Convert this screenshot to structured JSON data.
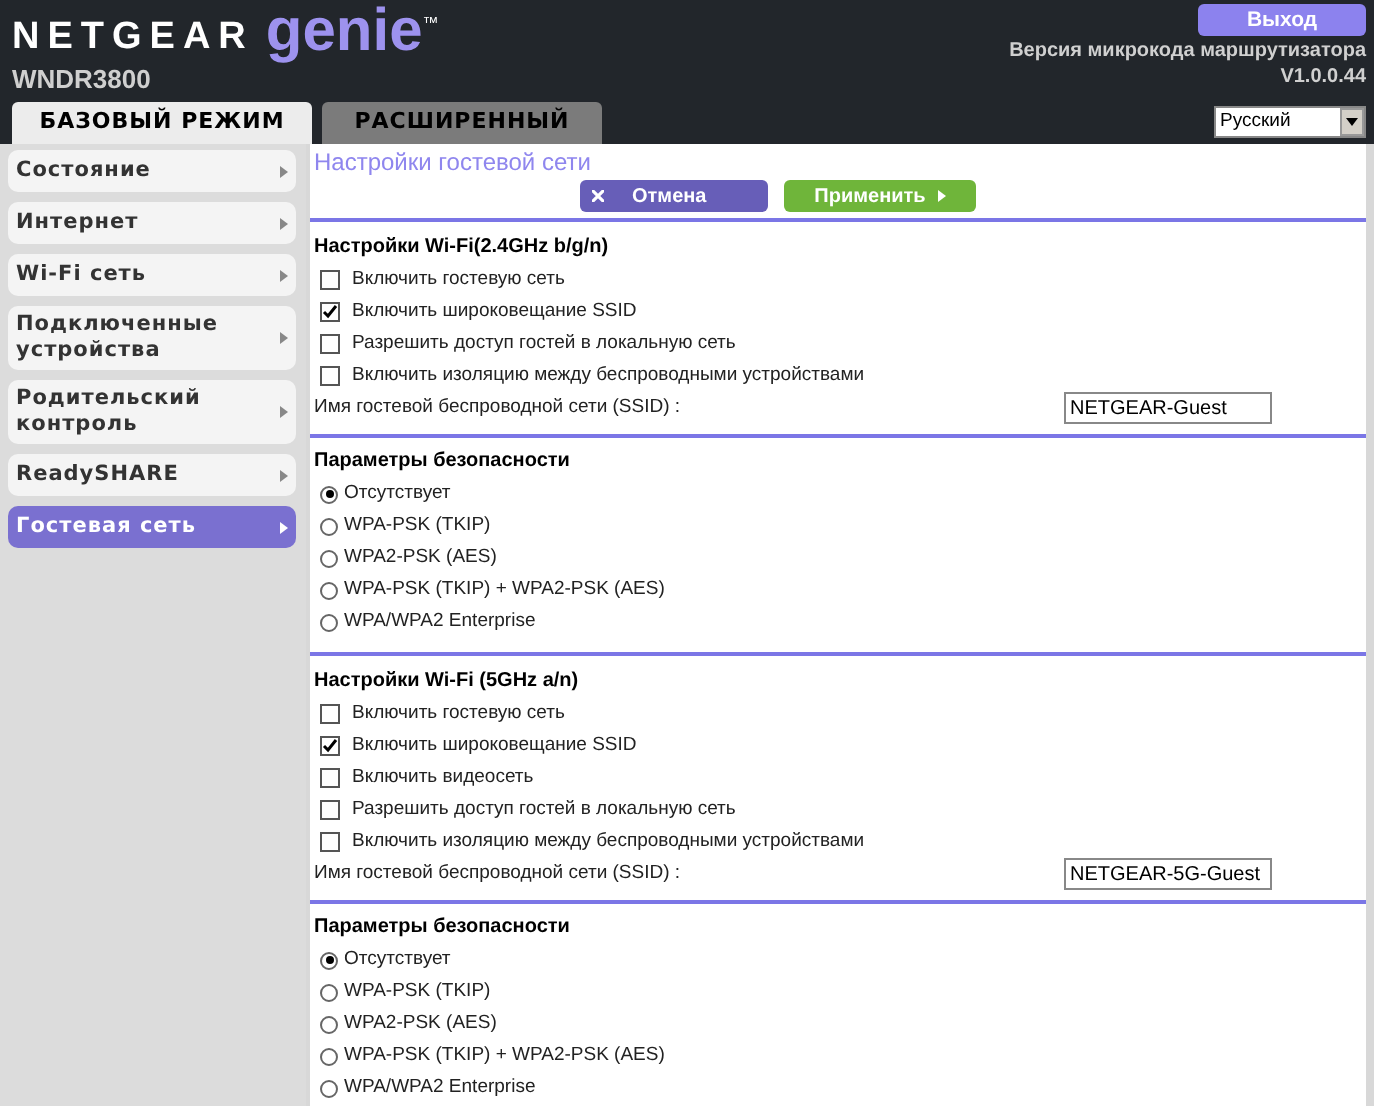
{
  "header": {
    "brand": "NETGEAR",
    "product": "genie",
    "trademark": "™",
    "model": "WNDR3800",
    "logout": "Выход",
    "firmware_label": "Версия микрокода маршрутизатора",
    "firmware_version": "V1.0.0.44"
  },
  "tabs": [
    {
      "label": "БАЗОВЫЙ РЕЖИМ",
      "selected": true
    },
    {
      "label": "РАСШИРЕННЫЙ",
      "selected": false
    }
  ],
  "language": {
    "value": "Русский"
  },
  "sidebar": {
    "items": [
      {
        "label": "Состояние",
        "selected": false
      },
      {
        "label": "Интернет",
        "selected": false
      },
      {
        "label": "Wi-Fi сеть",
        "selected": false
      },
      {
        "label": "Подключенные устройства",
        "selected": false
      },
      {
        "label": "Родительский контроль",
        "selected": false
      },
      {
        "label": "ReadySHARE",
        "selected": false
      },
      {
        "label": "Гостевая сеть",
        "selected": true
      }
    ]
  },
  "page": {
    "title": "Настройки гостевой сети",
    "cancel": "Отмена",
    "apply": "Применить"
  },
  "sections": [
    {
      "kind": "wifi",
      "title": "Настройки Wi-Fi(2.4GHz b/g/n)",
      "options": [
        {
          "label": "Включить гостевую сеть",
          "checked": false
        },
        {
          "label": "Включить широковещание SSID",
          "checked": true
        },
        {
          "label": "Разрешить доступ гостей в локальную сеть",
          "checked": false
        },
        {
          "label": "Включить изоляцию между беспроводными устройствами",
          "checked": false
        }
      ],
      "ssid_label": "Имя гостевой беспроводной сети (SSID) :",
      "ssid_value": "NETGEAR-Guest"
    },
    {
      "kind": "security",
      "title": "Параметры безопасности",
      "options": [
        {
          "label": "Отсутствует",
          "selected": true
        },
        {
          "label": "WPA-PSK (TKIP)",
          "selected": false
        },
        {
          "label": "WPA2-PSK (AES)",
          "selected": false
        },
        {
          "label": "WPA-PSK (TKIP) + WPA2-PSK (AES)",
          "selected": false
        },
        {
          "label": "WPA/WPA2 Enterprise",
          "selected": false
        }
      ]
    },
    {
      "kind": "wifi",
      "title": "Настройки Wi-Fi (5GHz a/n)",
      "options": [
        {
          "label": "Включить гостевую сеть",
          "checked": false
        },
        {
          "label": "Включить широковещание SSID",
          "checked": true
        },
        {
          "label": "Включить видеосеть",
          "checked": false
        },
        {
          "label": "Разрешить доступ гостей в локальную сеть",
          "checked": false
        },
        {
          "label": "Включить изоляцию между беспроводными устройствами",
          "checked": false
        }
      ],
      "ssid_label": "Имя гостевой беспроводной сети (SSID) :",
      "ssid_value": "NETGEAR-5G-Guest"
    },
    {
      "kind": "security",
      "title": "Параметры безопасности",
      "options": [
        {
          "label": "Отсутствует",
          "selected": true
        },
        {
          "label": "WPA-PSK (TKIP)",
          "selected": false
        },
        {
          "label": "WPA2-PSK (AES)",
          "selected": false
        },
        {
          "label": "WPA-PSK (TKIP) + WPA2-PSK (AES)",
          "selected": false
        },
        {
          "label": "WPA/WPA2 Enterprise",
          "selected": false
        }
      ]
    }
  ]
}
